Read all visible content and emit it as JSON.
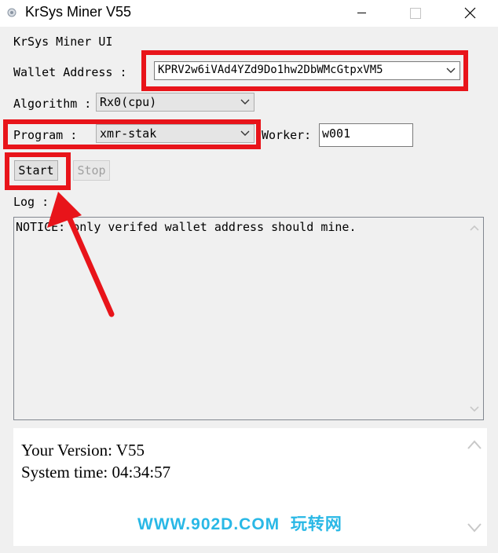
{
  "window": {
    "title": "KrSys Miner V55",
    "icons": {
      "app": "app-icon",
      "minimize": "minimize-icon",
      "maximize": "maximize-icon",
      "close": "close-icon"
    }
  },
  "form": {
    "heading": "KrSys Miner UI",
    "wallet_label": "Wallet Address :",
    "wallet_value": "KPRV2w6iVAd4YZd9Do1hw2DbWMcGtpxVM5",
    "algorithm_label": "Algorithm :",
    "algorithm_value": "Rx0(cpu)",
    "program_label": "Program :",
    "program_value": "xmr-stak",
    "worker_label": "Worker:",
    "worker_value": "w001",
    "start_label": "Start",
    "stop_label": "Stop",
    "log_label": "Log :"
  },
  "log": {
    "text": "NOTICE: only verifed wallet address should mine."
  },
  "info": {
    "version_line": "Your Version: V55",
    "time_line": "System time: 04:34:57",
    "watermark": "WWW.902D.COM  玩转网"
  },
  "annotation": {
    "color": "#e8141a"
  }
}
